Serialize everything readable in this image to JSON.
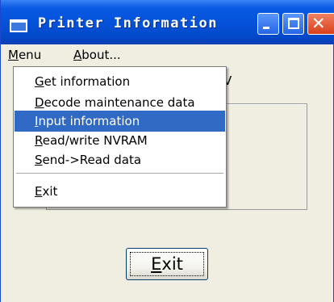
{
  "window": {
    "title": "Printer Information",
    "partial_text": "V"
  },
  "menubar": [
    {
      "key": "M",
      "rest": "enu",
      "active": true
    },
    {
      "key": "A",
      "rest": "bout...",
      "active": false
    }
  ],
  "menu_items": [
    {
      "key": "G",
      "rest": "et information",
      "selected": false
    },
    {
      "key": "D",
      "rest": "ecode maintenance data",
      "selected": false
    },
    {
      "key": "I",
      "rest": "nput information",
      "selected": true
    },
    {
      "key": "R",
      "rest": "ead/write NVRAM",
      "selected": false
    },
    {
      "key": "S",
      "rest": "end->Read data",
      "selected": false
    },
    {
      "key": "E",
      "rest": "xit",
      "selected": false
    }
  ],
  "exit_button": {
    "key": "E",
    "rest": "xit"
  }
}
